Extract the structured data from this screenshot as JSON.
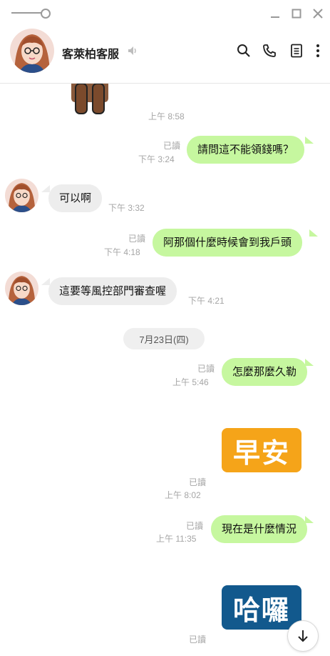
{
  "window": {
    "controls": [
      "minimize-icon",
      "maximize-icon",
      "close-icon"
    ]
  },
  "header": {
    "contact_name": "客萊柏客服",
    "actions": [
      "search-icon",
      "phone-icon",
      "notes-icon",
      "more-icon"
    ]
  },
  "messages": [
    {
      "type": "sticker-partial",
      "time": "上午 8:58"
    },
    {
      "type": "out",
      "text": "請問這不能領錢嗎？",
      "read": "已讀",
      "time": "下午 3:24"
    },
    {
      "type": "in",
      "text": "可以啊",
      "time": "下午 3:32"
    },
    {
      "type": "out",
      "text": "阿那個什麼時候會到我戶頭",
      "read": "已讀",
      "time": "下午 4:18"
    },
    {
      "type": "in",
      "text": "這要等風控部門審查喔",
      "time": "下午 4:21"
    },
    {
      "type": "date",
      "text": "7月23日(四)"
    },
    {
      "type": "out",
      "text": "怎麼那麼久勒",
      "read": "已讀",
      "time": "上午 5:46"
    },
    {
      "type": "sticker",
      "text": "早安",
      "read": "已讀",
      "time": "上午 8:02"
    },
    {
      "type": "out",
      "text": "現在是什麼情況",
      "read": "已讀",
      "time": "上午 11:35"
    },
    {
      "type": "sticker",
      "text": "哈囉",
      "read": "已讀"
    }
  ],
  "colors": {
    "outgoing_bubble": "#c6f79f",
    "incoming_bubble": "#ededed",
    "sticker_zao": "#f5a419",
    "sticker_haluo": "#12598d"
  }
}
